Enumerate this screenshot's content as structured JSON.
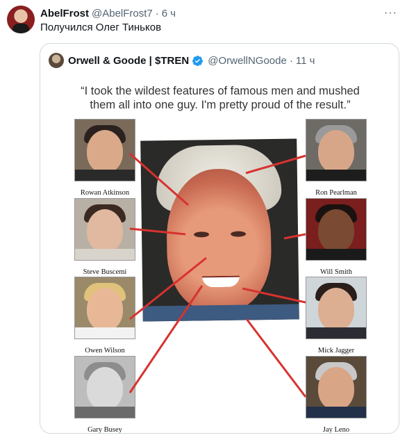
{
  "post": {
    "author_name": "AbelFrost",
    "author_handle": "@AbelFrost7",
    "separator": "·",
    "time": "6 ч",
    "more": "···",
    "text": "Получился Олег Тиньков"
  },
  "quoted": {
    "author_name": "Orwell & Goode | $TREN",
    "author_handle": "@OrwellNGoode",
    "separator": "·",
    "time": "11 ч",
    "verified_color": "#1d9bf0",
    "image": {
      "quote_line1": "“I took the wildest features of famous men and mushed",
      "quote_line2": "them all into one guy. I'm pretty proud of the result.”",
      "left_labels": [
        "Rowan Atkinson",
        "Steve Buscemi",
        "Owen Wilson",
        "Gary Busey"
      ],
      "right_labels": [
        "Ron Pearlman",
        "Will Smith",
        "Mick Jagger",
        "Jay Leno"
      ],
      "line_color": "#d8322f"
    }
  },
  "colors": {
    "text_primary": "#0f1419",
    "text_secondary": "#536471",
    "border": "#cfd9de"
  }
}
